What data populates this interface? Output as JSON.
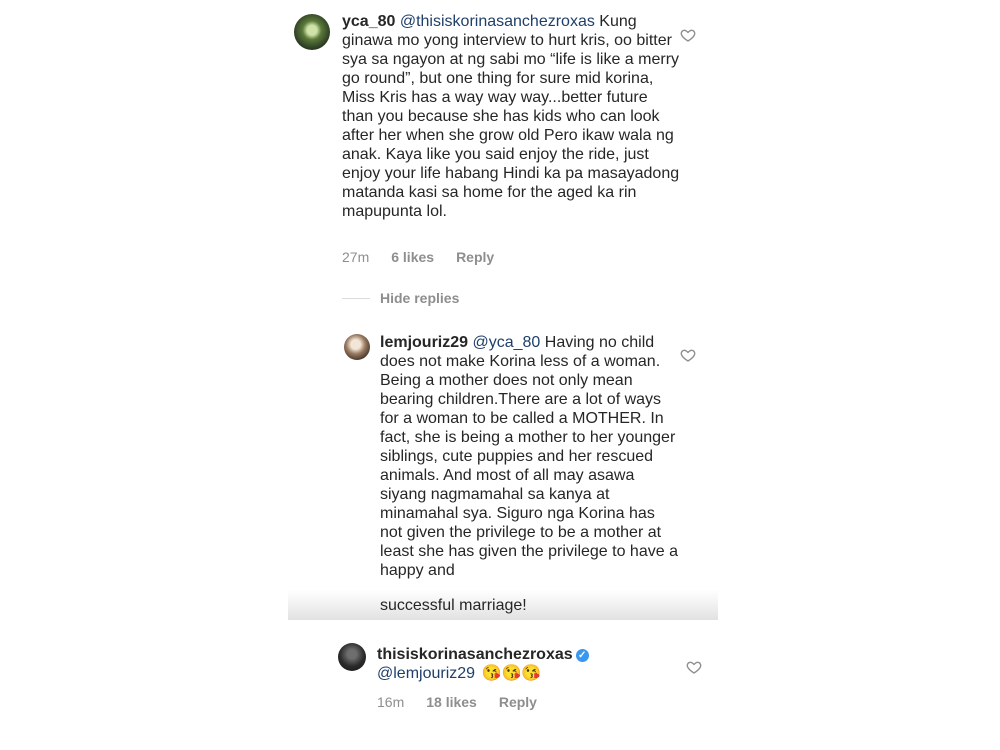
{
  "comments": [
    {
      "username": "yca_80",
      "mention": "@thisiskorinasanchezroxas",
      "text": " Kung ginawa mo yong interview to hurt kris, oo bitter sya sa ngayon at ng sabi mo “life is like a merry go round”, but one thing for sure mid korina, Miss Kris has a way way way...better future than you because she has kids who can look after her when she grow old Pero ikaw wala ng anak. Kaya like you said enjoy the ride, just enjoy your life habang Hindi ka pa masayadong matanda kasi sa home for the aged ka rin mapupunta lol.",
      "time": "27m",
      "likes": "6 likes",
      "reply_label": "Reply"
    },
    {
      "username": "lemjouriz29",
      "mention": "@yca_80",
      "text": " Having no child does not make Korina less of a woman. Being a mother does not only mean bearing children.There are a lot of ways for a woman  to be called a MOTHER. In fact, she is being a mother to her younger siblings, cute puppies and her rescued animals. And most of all may asawa siyang nagmamahal sa kanya at minamahal sya. Siguro nga Korina has not given the privilege to be a mother at least she has given the privilege to have a happy and",
      "text_last_line": "successful marriage!"
    },
    {
      "username": "thisiskorinasanchezroxas",
      "verified": true,
      "mention": "@lemjouriz29",
      "emojis": "😘😘😘",
      "time": "16m",
      "likes": "18 likes",
      "reply_label": "Reply"
    }
  ],
  "hide_replies_label": "Hide replies",
  "icons": {
    "like": "heart-outline-icon",
    "verified": "verified-badge-icon"
  },
  "colors": {
    "text": "#262626",
    "meta": "#8e8e8e",
    "verified": "#3897f0"
  }
}
